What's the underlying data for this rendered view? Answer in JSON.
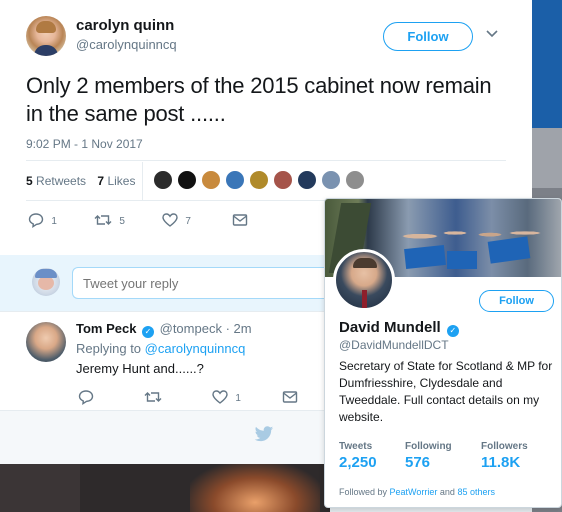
{
  "tweet": {
    "author_name": "carolyn quinn",
    "author_handle": "@carolynquinncq",
    "follow_label": "Follow",
    "text": "Only 2 members of the 2015 cabinet now remain in the same post ......",
    "timestamp": "9:02 PM - 1 Nov 2017",
    "retweets_count": "5",
    "retweets_label": "Retweets",
    "likes_count": "7",
    "likes_label": "Likes",
    "actions": {
      "reply": "1",
      "retweet": "5",
      "like": "7"
    }
  },
  "reply_box": {
    "placeholder": "Tweet your reply"
  },
  "reply_tweet": {
    "author_name": "Tom Peck",
    "author_handle": "@tompeck",
    "time": "· 2m",
    "replying_prefix": "Replying to",
    "replying_to": "@carolynquinncq",
    "text": "Jeremy Hunt and......?",
    "actions": {
      "like": "1"
    }
  },
  "profile_card": {
    "name": "David Mundell",
    "handle": "@DavidMundellDCT",
    "follow_label": "Follow",
    "bio": "Secretary of State for Scotland & MP for Dumfriesshire, Clydesdale and Tweeddale. Full contact details on my website.",
    "stats": [
      {
        "label": "Tweets",
        "value": "2,250"
      },
      {
        "label": "Following",
        "value": "576"
      },
      {
        "label": "Followers",
        "value": "11.8K"
      }
    ],
    "followed_by_prefix": "Followed by",
    "followed_by_user": "PeatWorrier",
    "followed_by_and": "and",
    "followed_by_others": "85 others"
  },
  "colors": {
    "accent": "#1da1f2",
    "text": "#14171a",
    "muted": "#657786"
  },
  "icons": [
    "reply-icon",
    "retweet-icon",
    "heart-icon",
    "message-icon",
    "chevron-down-icon",
    "verified-icon",
    "twitter-bird-icon"
  ]
}
